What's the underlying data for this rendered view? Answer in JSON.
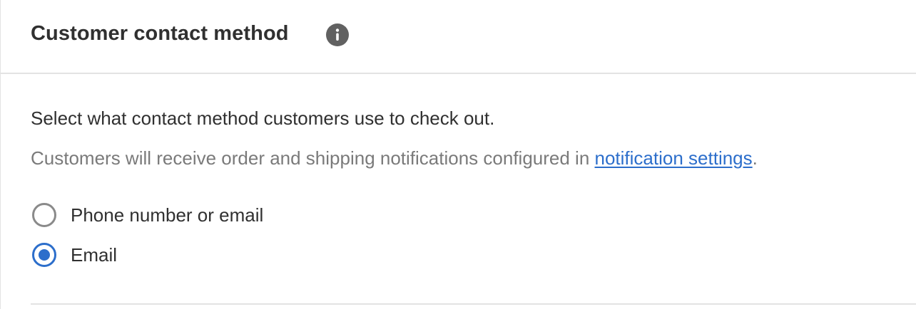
{
  "card": {
    "title": "Customer contact method",
    "info_icon": "info-icon",
    "description": "Select what contact method customers use to check out.",
    "help_text_prefix": "Customers will receive order and shipping notifications configured in ",
    "help_link": "notification settings",
    "help_text_suffix": "."
  },
  "options": [
    {
      "label": "Phone number or email",
      "selected": false
    },
    {
      "label": "Email",
      "selected": true
    }
  ],
  "colors": {
    "accent": "#2c6ecb",
    "text": "#303030",
    "muted": "#7a7a7a",
    "border": "#e3e3e3"
  }
}
